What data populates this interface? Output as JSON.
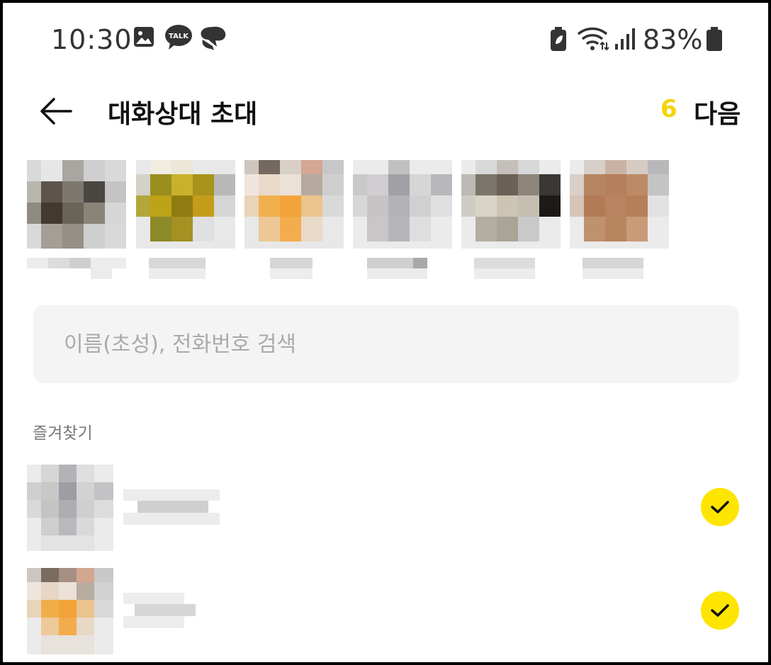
{
  "status_bar": {
    "time": "10:30",
    "talk_badge": "TALK",
    "battery_percent": "83%"
  },
  "header": {
    "title": "대화상대 초대",
    "selected_count": "6",
    "next_label": "다음"
  },
  "search": {
    "placeholder": "이름(초성), 전화번호 검색"
  },
  "favorites": {
    "section_label": "즐겨찾기"
  },
  "colors": {
    "accent_yellow": "#fee500",
    "count_yellow": "#f5d50a"
  }
}
